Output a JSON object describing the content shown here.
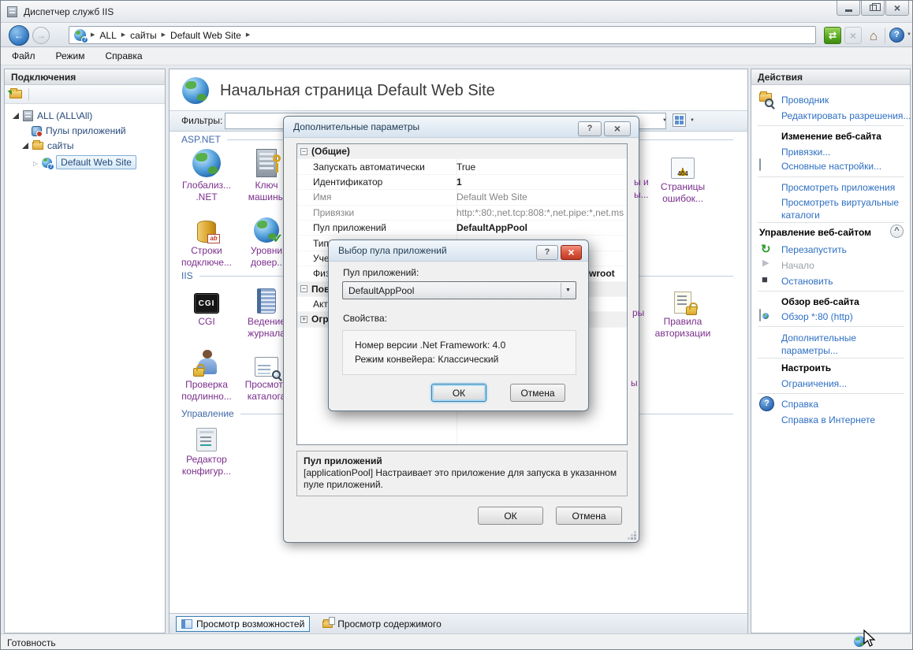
{
  "colors": {
    "link": "#2E6FC2",
    "feature_label": "#7A2E8C",
    "section_header": "#4169A8",
    "close_red": "#C03A24"
  },
  "window": {
    "title": "Диспетчер служб IIS",
    "status": "Готовность"
  },
  "menu": {
    "items": [
      "Файл",
      "Режим",
      "Справка"
    ]
  },
  "addressbar": {
    "crumbs": [
      "ALL",
      "сайты",
      "Default Web Site"
    ]
  },
  "connections": {
    "header": "Подключения",
    "tree": {
      "root": "ALL (ALL\\All)",
      "app_pools": "Пулы приложений",
      "sites": "сайты",
      "default_site": "Default Web Site"
    }
  },
  "content": {
    "title": "Начальная страница Default Web Site",
    "filters_label": "Фильтры:",
    "sections": {
      "aspnet": "ASP.NET",
      "iis": "IIS",
      "management": "Управление"
    },
    "features": {
      "globalization": [
        "Глобализ...",
        ".NET"
      ],
      "machine_key": [
        "Ключ",
        "машины"
      ],
      "error_pages": [
        "Страницы",
        "ошибок..."
      ],
      "error_pages_badge": "404",
      "conn_strings": [
        "Строки",
        "подключе..."
      ],
      "trust_levels": [
        "Уровни",
        "довер.."
      ],
      "cgi": [
        "CGI",
        ""
      ],
      "logging": [
        "Ведение",
        "журнала"
      ],
      "auth_rules": [
        "Правила",
        "авторизации"
      ],
      "authentication": [
        "Проверка",
        "подлинно..."
      ],
      "dir_browsing": [
        "Просмотр",
        "каталога"
      ],
      "config_editor": [
        "Редактор",
        "конфигур..."
      ]
    },
    "fragments": {
      "f1": "ы и",
      "f2": "ы...",
      "f3": "ры",
      "f4": "ы"
    },
    "tabs": {
      "features": "Просмотр возможностей",
      "content": "Просмотр содержимого"
    }
  },
  "actions": {
    "header": "Действия",
    "explorer": "Проводник",
    "edit_permissions": "Редактировать разрешения...",
    "edit_site_header": "Изменение веб-сайта",
    "bindings": "Привязки...",
    "basic_settings": "Основные настройки...",
    "view_applications": "Просмотреть приложения",
    "view_virtual_dirs": "Просмотреть виртуальные каталоги",
    "manage_site_header": "Управление веб-сайтом",
    "restart": "Перезапустить",
    "start": "Начало",
    "stop": "Остановить",
    "browse_header": "Обзор веб-сайта",
    "browse_80": "Обзор *:80 (http)",
    "advanced": "Дополнительные параметры...",
    "configure_header": "Настроить",
    "limits": "Ограничения...",
    "help": "Справка",
    "help_online": "Справка в Интернете"
  },
  "dialog_advanced": {
    "title": "Дополнительные параметры",
    "grid": {
      "section_general": "(Общие)",
      "rows": [
        {
          "label": "Запускать автоматически",
          "value": "True"
        },
        {
          "label": "Идентификатор",
          "value": "1"
        },
        {
          "label": "Имя",
          "value": "Default Web Site"
        },
        {
          "label": "Привязки",
          "value": "http:*:80:,net.tcp:808:*,net.pipe:*,net.ms"
        },
        {
          "label": "Пул приложений",
          "value": "DefaultAppPool"
        },
        {
          "label": "Тип",
          "value": ""
        },
        {
          "label": "Учет",
          "value": ""
        },
        {
          "label": "Физ",
          "value": "wroot"
        }
      ],
      "section_behavior": "Пов",
      "row_active": "Акти",
      "section_limits": "Огр"
    },
    "description": {
      "title": "Пул приложений",
      "text": "[applicationPool] Настраивает это приложение для запуска в указанном пуле приложений."
    },
    "ok": "ОК",
    "cancel": "Отмена"
  },
  "dialog_pool": {
    "title": "Выбор пула приложений",
    "pool_label": "Пул приложений:",
    "pool_value": "DefaultAppPool",
    "properties_label": "Свойства:",
    "prop_line1": "Номер версии .Net Framework: 4.0",
    "prop_line2": "Режим конвейера: Классический",
    "ok": "ОК",
    "cancel": "Отмена"
  }
}
